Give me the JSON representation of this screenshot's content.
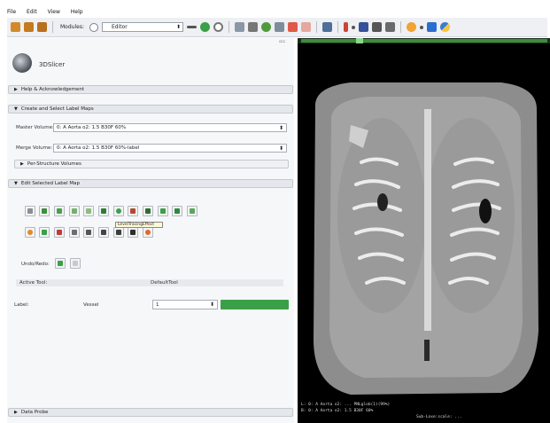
{
  "menu": [
    "File",
    "Edit",
    "View",
    "Help"
  ],
  "toolbar": {
    "modules_label": "Modules:",
    "module_selected": "Editor",
    "icons": [
      "load-data-icon",
      "save-icon",
      "dicom-icon",
      "search-icon",
      "minus-icon",
      "forward-icon",
      "history-icon",
      "grid-icon",
      "layout-icon",
      "model-icon",
      "transform-icon",
      "annotation-icon",
      "fiducial-icon",
      "layout-select-icon",
      "crosshair-icon",
      "screenshot-icon",
      "extension-icon",
      "python-icon",
      "help-icon"
    ]
  },
  "panel": {
    "logo_text": "3DSlicer",
    "sections": {
      "help": "Help & Acknowledgement",
      "create": "Create and Select Label Maps",
      "edit": "Edit Selected Label Map",
      "probe": "Data Probe"
    },
    "master_volume_label": "Master Volume:",
    "master_volume_value": "0: A Aorta o2: 1.5 B30F 60%",
    "merge_volume_label": "Merge Volume:",
    "merge_volume_value": "0: A Aorta o2: 1.5 B30F 60%-label",
    "per_structure_label": "Per-Structure Volumes",
    "tooltip": "LevelTracingEffect",
    "undo_redo_label": "Undo/Redo:",
    "active_tool_label": "Active Tool:",
    "active_tool_value": "DefaultTool",
    "label_label": "Label:",
    "label_name": "Vessel",
    "label_value": "1"
  },
  "viewer": {
    "overlay_line1": "L: 0: A Aorta o2: ... PNLglob(1)(99%)",
    "overlay_line2": "B: 0: A Aorta o2: 1.5 B30F 60%",
    "overlay_bottom": "Sub-Loxe:scale: ..."
  },
  "colors": {
    "accent_green": "#3aa048",
    "panel_bg": "#f6f7f9",
    "viewer_bg": "#000000"
  }
}
